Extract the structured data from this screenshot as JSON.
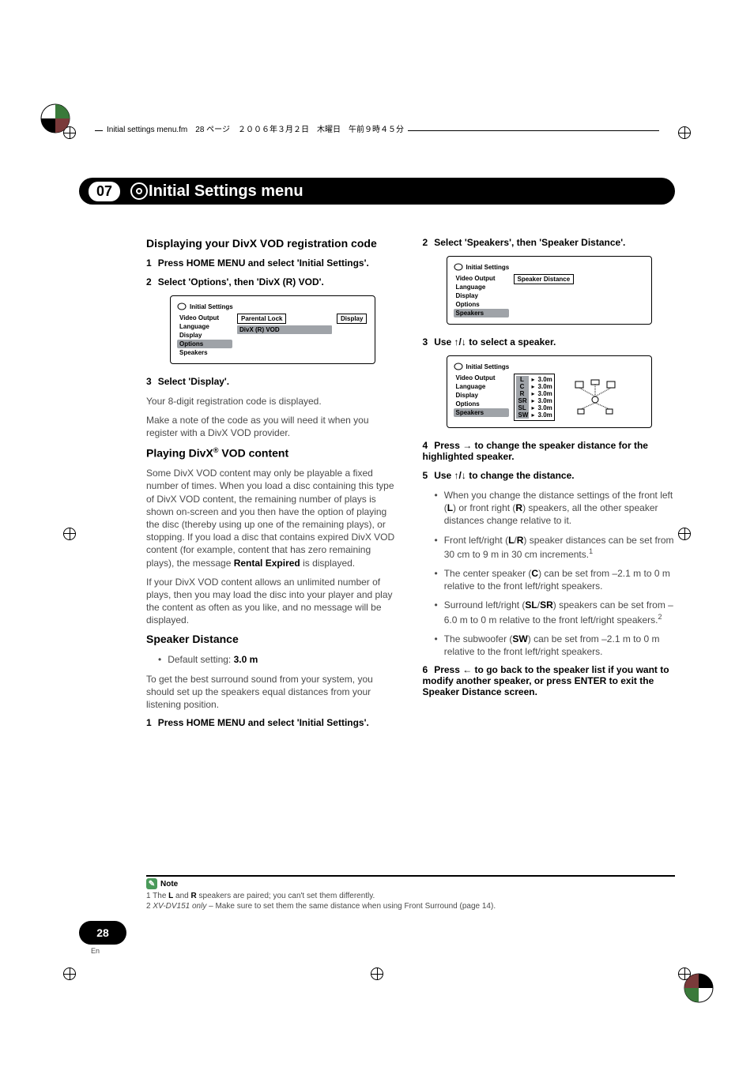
{
  "header": {
    "line": "Initial settings menu.fm　28 ページ　２００６年３月２日　木曜日　午前９時４５分"
  },
  "chapter": {
    "number": "07",
    "title": "Initial Settings menu"
  },
  "left": {
    "h1": "Displaying your DivX VOD registration code",
    "step1_num": "1",
    "step1_text": "Press HOME MENU and select 'Initial Settings'.",
    "step2_num": "2",
    "step2_text": "Select 'Options', then 'DivX (R) VOD'.",
    "osd1": {
      "title": "Initial Settings",
      "menu": [
        "Video Output",
        "Language",
        "Display",
        "Options",
        "Speakers"
      ],
      "selected": "Options",
      "col2_label": "Parental Lock",
      "col2_option": "DivX (R) VOD",
      "col3_label": "Display"
    },
    "step3_num": "3",
    "step3_text": "Select 'Display'.",
    "body1": "Your 8-digit registration code is displayed.",
    "body2": "Make a note of the code as you will need it when you register with a DivX VOD provider.",
    "h2_prefix": "Playing DivX",
    "h2_sup": "®",
    "h2_suffix": " VOD content",
    "body3a": "Some DivX VOD content may only be playable a fixed number of times. When you load a disc containing this type of DivX VOD content, the remaining number of plays is shown on-screen and you then have the option of playing the disc (thereby using up one of the remaining plays), or stopping. If you load a disc that contains expired DivX VOD content (for example, content that has zero remaining plays), the message ",
    "body3_bold": "Rental Expired",
    "body3b": " is displayed.",
    "body4": "If your DivX VOD content allows an unlimited number of plays, then you may load the disc into your player and play the content as often as you like, and no message will be displayed.",
    "h3": "Speaker Distance",
    "default_label": "Default setting: ",
    "default_val": "3.0 m",
    "body5": "To get the best surround sound from your system, you should set up the speakers equal distances from your listening position.",
    "step4_num": "1",
    "step4_text": "Press HOME MENU and select 'Initial Settings'."
  },
  "right": {
    "step2_num": "2",
    "step2_text": "Select 'Speakers', then 'Speaker Distance'.",
    "osd2": {
      "title": "Initial Settings",
      "menu": [
        "Video Output",
        "Language",
        "Display",
        "Options",
        "Speakers"
      ],
      "selected": "Speakers",
      "label": "Speaker Distance"
    },
    "step3_num": "3",
    "step3_text": "Use / to select a speaker.",
    "osd3": {
      "title": "Initial Settings",
      "menu": [
        "Video Output",
        "Language",
        "Display",
        "Options",
        "Speakers"
      ],
      "selected": "Speakers",
      "speakers": [
        {
          "l": "L",
          "v": "3.0m"
        },
        {
          "l": "C",
          "v": "3.0m"
        },
        {
          "l": "R",
          "v": "3.0m"
        },
        {
          "l": "SR",
          "v": "3.0m"
        },
        {
          "l": "SL",
          "v": "3.0m"
        },
        {
          "l": "SW",
          "v": "3.0m"
        }
      ]
    },
    "step4_num": "4",
    "step4_text": "Press  to change the speaker distance for the highlighted speaker.",
    "step5_num": "5",
    "step5_text": "Use / to change the distance.",
    "b1a": "When you change the distance settings of the front left (",
    "b1_L": "L",
    "b1b": ") or front right (",
    "b1_R": "R",
    "b1c": ") speakers, all the other speaker distances change relative to it.",
    "b2a": "Front left/right (",
    "b2_L": "L",
    "b2_slash": "/",
    "b2_R": "R",
    "b2b": ") speaker distances can be set from 30 cm to 9 m in 30 cm increments.",
    "b2_sup": "1",
    "b3a": "The center speaker (",
    "b3_C": "C",
    "b3b": ") can be set from –2.1 m to 0 m relative to the front left/right speakers.",
    "b4a": "Surround left/right (",
    "b4_SL": "SL",
    "b4_slash": "/",
    "b4_SR": "SR",
    "b4b": ") speakers can be set from –6.0 m to 0 m relative to the front left/right speakers.",
    "b4_sup": "2",
    "b5a": "The subwoofer (",
    "b5_SW": "SW",
    "b5b": ") can be set from –2.1 m to 0 m relative to the front left/right speakers.",
    "step6_num": "6",
    "step6_text": "Press  to go back to the speaker list if you want to modify another speaker, or press ENTER to exit the Speaker Distance screen."
  },
  "note": {
    "label": "Note",
    "n1_prefix": "1 The ",
    "n1_L": "L",
    "n1_mid": " and ",
    "n1_R": "R",
    "n1_suffix": " speakers are paired; you can't set them differently.",
    "n2_prefix": "2 ",
    "n2_italic": "XV-DV151 only",
    "n2_suffix": " – Make sure to set them the same distance when using Front Surround (page 14)."
  },
  "page": {
    "number": "28",
    "lang": "En"
  }
}
